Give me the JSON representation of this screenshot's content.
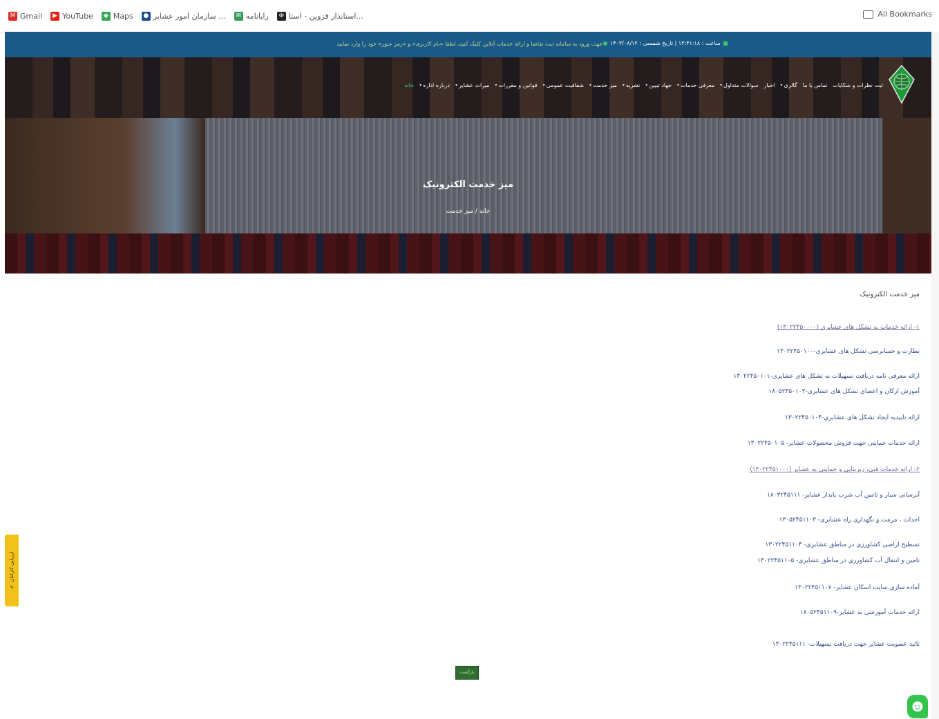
{
  "bookmarks": {
    "items": [
      {
        "label": "Gmail",
        "icon": "gmail-icon",
        "color": "#d93025",
        "glyph": "M"
      },
      {
        "label": "YouTube",
        "icon": "youtube-icon",
        "color": "#e62117",
        "glyph": "▶"
      },
      {
        "label": "Maps",
        "icon": "maps-icon",
        "color": "#34a853",
        "glyph": "◆"
      },
      {
        "label": "سازمان امور عشایر ...",
        "icon": "globe-icon",
        "color": "#1a4d8f",
        "glyph": "●"
      },
      {
        "label": "رایانامه",
        "icon": "mail-icon",
        "color": "#3a9a5a",
        "glyph": "✉"
      },
      {
        "label": "استاندار قزوین - استا...",
        "icon": "iran-emblem-icon",
        "color": "#222222",
        "glyph": "☫"
      }
    ],
    "all_label": "All Bookmarks"
  },
  "topbar": {
    "notice": "جهت ورود به سامانه ثبت تقاضا و ارائه خدمات آنلاین کلیک کنید، لطفا «نام کاربری» و «رمز عبور» خود را وارد نمایید",
    "clock": "ساعت : ۱۳:۴۱:۱۸  |  تاریخ شمسی : ۱۴۰۳/۰۸/۱۲"
  },
  "nav": {
    "items": [
      {
        "label": "خانه",
        "has_menu": false
      },
      {
        "label": "درباره اداره",
        "has_menu": true
      },
      {
        "label": "میراث عشایر",
        "has_menu": true
      },
      {
        "label": "قوانین و مقررات",
        "has_menu": true
      },
      {
        "label": "شفافیت عمومی",
        "has_menu": true
      },
      {
        "label": "میز خدمت",
        "has_menu": true
      },
      {
        "label": "نشریه",
        "has_menu": true
      },
      {
        "label": "جهاد تبیین",
        "has_menu": true
      },
      {
        "label": "معرفی خدمات",
        "has_menu": true
      },
      {
        "label": "سوالات متداول",
        "has_menu": true
      },
      {
        "label": "اخبار",
        "has_menu": false
      },
      {
        "label": "گالری",
        "has_menu": true
      },
      {
        "label": "تماس با ما",
        "has_menu": false
      },
      {
        "label": "ثبت نظرات و شکایات",
        "has_menu": false
      }
    ]
  },
  "hero": {
    "title": "میز خدمت الکترونیک",
    "breadcrumb": "خانه / میز خدمت"
  },
  "content": {
    "section_title": "میز خدمت الکترونیک",
    "services": [
      {
        "text": "۱- ارائه خدمات به تشکل های عشایری (۱۳۰۲۲۴۵۰۰۰۰)",
        "head": true
      },
      {
        "text": "نظارت و حسابرسی تشکل های عشایری-۱۳۰۲۲۴۵۰۱۰۰",
        "head": false
      },
      {
        "text": "ارائه معرفی نامه دریافت تسهیلات به تشکل های عشایری-۱۳۰۲۲۴۵۰۱۰۱",
        "head": false
      },
      {
        "text": "آموزش ارکان و اعضای تشکل های عشایری-۱۸۰۵۲۴۵۰۱۰۳",
        "head": false
      },
      {
        "text": "ارائه تاییدیه ایجاد تشکل های عشایری-۱۳۰۲۲۴۵۰۱۰۴",
        "head": false
      },
      {
        "text": "ارائه خدمات حمایتی جهت فروش محصولات عشایر- ۱۳۰۲۲۴۵۰۱۰۵",
        "head": false
      },
      {
        "text": "۲- ارائه خدمات فنی، زیربنایی و حمایتی به عشایر (۱۳۰۲۲۴۵۱۰۰۰)",
        "head": true
      },
      {
        "text": "آبرسانی سیار و تامین آب شرب پایدار عشایر- ۱۸۰۳۲۴۵۱۱۱",
        "head": false
      },
      {
        "text": "احداث ، مرمت و نگهداری راه عشایری- ۱۳۰۵۲۴۵۱۱۰۳",
        "head": false
      },
      {
        "text": "تسطیح اراضی کشاورزی در مناطق عشایری- ۱۳۰۲۲۴۵۱۱۰۴",
        "head": false
      },
      {
        "text": "تامین و انتقال آب کشاورزی در مناطق عشایری- ۱۳۰۲۲۴۵۱۱۰۵",
        "head": false
      },
      {
        "text": "آماده سازی سایت اسکان عشایر- ۱۳۰۲۲۴۵۱۱۰۷",
        "head": false
      },
      {
        "text": "ارائه خدمات آموزشی به عشایر-۱۸۰۵۲۴۵۱۱۰۹",
        "head": false
      },
      {
        "text": "تائید عضویت عشایر جهت دریافت تسهیلات- ۱۳۰۲۲۴۵۱۱۱",
        "head": false
      }
    ],
    "button_label": "بازگشت"
  },
  "feedback_label": "✎ ارزیابی کارکنان"
}
